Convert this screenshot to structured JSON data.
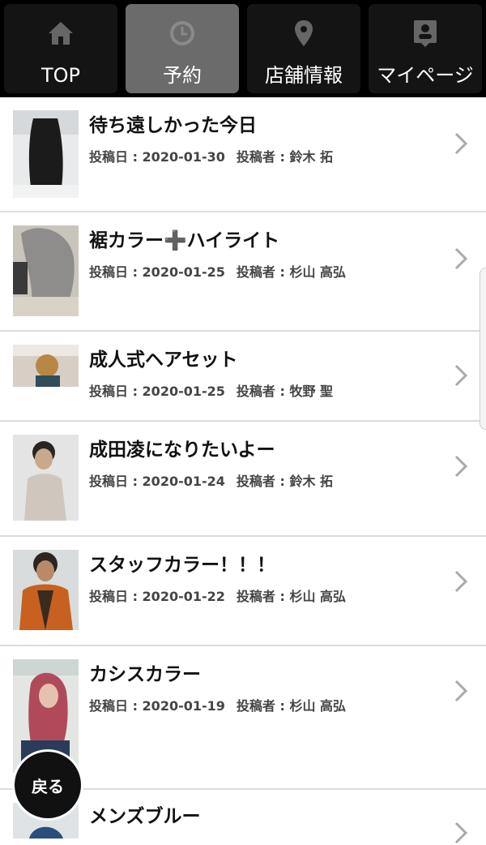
{
  "nav": {
    "tabs": [
      {
        "label": "TOP",
        "icon": "home-icon",
        "active": false
      },
      {
        "label": "予約",
        "icon": "clock-icon",
        "active": true
      },
      {
        "label": "店舗情報",
        "icon": "map-pin-icon",
        "active": false
      },
      {
        "label": "マイページ",
        "icon": "user-badge-icon",
        "active": false
      }
    ]
  },
  "labels": {
    "date_prefix": "投稿日 : ",
    "author_prefix": "投稿者 : "
  },
  "posts": [
    {
      "title": "待ち遠しかった今日",
      "date": "2020-01-30",
      "author": "鈴木 拓"
    },
    {
      "title": "裾カラー➕ハイライト",
      "date": "2020-01-25",
      "author": "杉山 高弘"
    },
    {
      "title": "成人式ヘアセット",
      "date": "2020-01-25",
      "author": "牧野 聖"
    },
    {
      "title": "成田凌になりたいよー",
      "date": "2020-01-24",
      "author": "鈴木 拓"
    },
    {
      "title": "スタッフカラー！！！",
      "date": "2020-01-22",
      "author": "杉山 高弘"
    },
    {
      "title": "カシスカラー",
      "date": "2020-01-19",
      "author": "杉山 高弘"
    },
    {
      "title": "メンズブルー",
      "date": "",
      "author": ""
    }
  ],
  "back_button": {
    "label": "戻る"
  },
  "colors": {
    "nav_bg": "#000000",
    "tab_bg": "#141414",
    "tab_active_bg": "#6b6b6b",
    "divider": "#dcdcdc"
  }
}
